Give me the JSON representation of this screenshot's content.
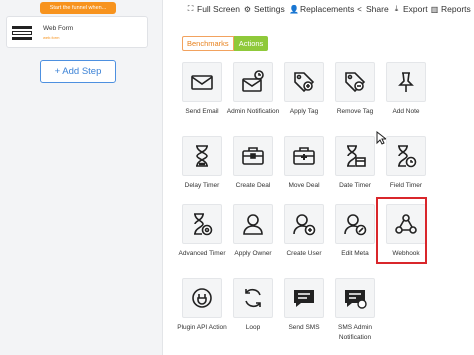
{
  "left_panel": {
    "trigger_pill": "Start the funnel when...",
    "step": {
      "title": "Web Form",
      "subtitle": "web.form"
    },
    "add_step": "+ Add Step"
  },
  "toolbar": {
    "items": [
      {
        "icon": "fullscreen-icon",
        "label": "Full Screen"
      },
      {
        "icon": "gear-icon",
        "label": "Settings"
      },
      {
        "icon": "user-icon",
        "label": "Replacements"
      },
      {
        "icon": "share-icon",
        "label": "Share"
      },
      {
        "icon": "download-icon",
        "label": "Export"
      },
      {
        "icon": "bar-chart-icon",
        "label": "Reports"
      }
    ]
  },
  "tabs": {
    "benchmarks": "Benchmarks",
    "actions": "Actions",
    "active": "actions"
  },
  "actions": [
    {
      "label": "Send Email",
      "icon": "envelope-icon"
    },
    {
      "label": "Admin Notification",
      "icon": "alarm-envelope-icon"
    },
    {
      "label": "Apply Tag",
      "icon": "tag-plus-icon"
    },
    {
      "label": "Remove Tag",
      "icon": "tag-minus-icon"
    },
    {
      "label": "Add Note",
      "icon": "pin-icon"
    },
    {
      "label": "Delay Timer",
      "icon": "hourglass-icon"
    },
    {
      "label": "Create Deal",
      "icon": "briefcase-icon"
    },
    {
      "label": "Move Deal",
      "icon": "briefcase-plus-icon"
    },
    {
      "label": "Date Timer",
      "icon": "hourglass-calendar-icon"
    },
    {
      "label": "Field Timer",
      "icon": "hourglass-clock-icon"
    },
    {
      "label": "Advanced Timer",
      "icon": "hourglass-gear-icon"
    },
    {
      "label": "Apply Owner",
      "icon": "user-silhouette-icon"
    },
    {
      "label": "Create User",
      "icon": "user-plus-icon"
    },
    {
      "label": "Edit Meta",
      "icon": "user-edit-icon"
    },
    {
      "label": "Webhook",
      "icon": "webhook-icon"
    },
    {
      "label": "Plugin API Action",
      "icon": "plug-icon"
    },
    {
      "label": "Loop",
      "icon": "loop-icon"
    },
    {
      "label": "Send SMS",
      "icon": "chat-bubble-icon"
    },
    {
      "label": "SMS Admin Notification",
      "icon": "chat-bubble-alert-icon"
    }
  ],
  "selected_action": "Webhook",
  "colors": {
    "accent_orange": "#f7931e",
    "accent_green": "#8fc93a",
    "link_blue": "#3b82d6",
    "highlight_red": "#d9262b"
  }
}
